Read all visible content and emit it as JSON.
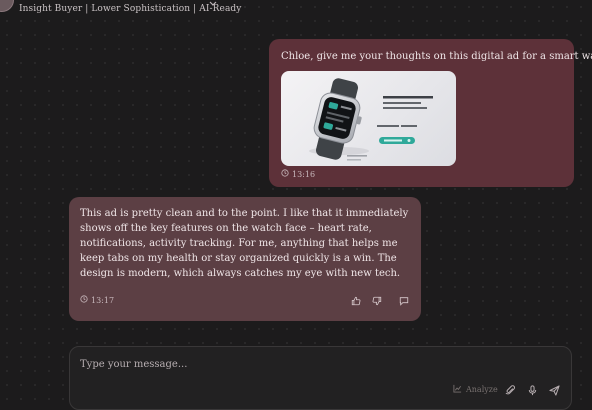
{
  "header": {
    "subtitle": "Insight Buyer | Lower Sophistication | AI-Ready"
  },
  "messages": [
    {
      "role": "user",
      "text": "Chloe, give me your thoughts on this digital ad for a smart watch",
      "attachment_icon": "smartwatch-ad-image",
      "time": "13:16"
    },
    {
      "role": "assistant",
      "text": "This ad is pretty clean and to the point. I like that it immediately shows off the key features on the watch face – heart rate, notifications, activity tracking. For me, anything that helps me keep tabs on my health or stay organized quickly is a win. The design is modern, which always catches my eye with new tech.",
      "time": "13:17",
      "actions": [
        "thumbs-up-icon",
        "thumbs-down-icon",
        "comment-icon"
      ]
    }
  ],
  "composer": {
    "placeholder": "Type your message...",
    "analyze_label": "Analyze",
    "tools": [
      "paperclip-icon",
      "microphone-icon",
      "send-icon"
    ]
  },
  "colors": {
    "background": "#1c1b1c",
    "user_bubble": "#5d3139",
    "assistant_bubble": "#5c3f44",
    "ad_accent": "#2fa99a"
  }
}
